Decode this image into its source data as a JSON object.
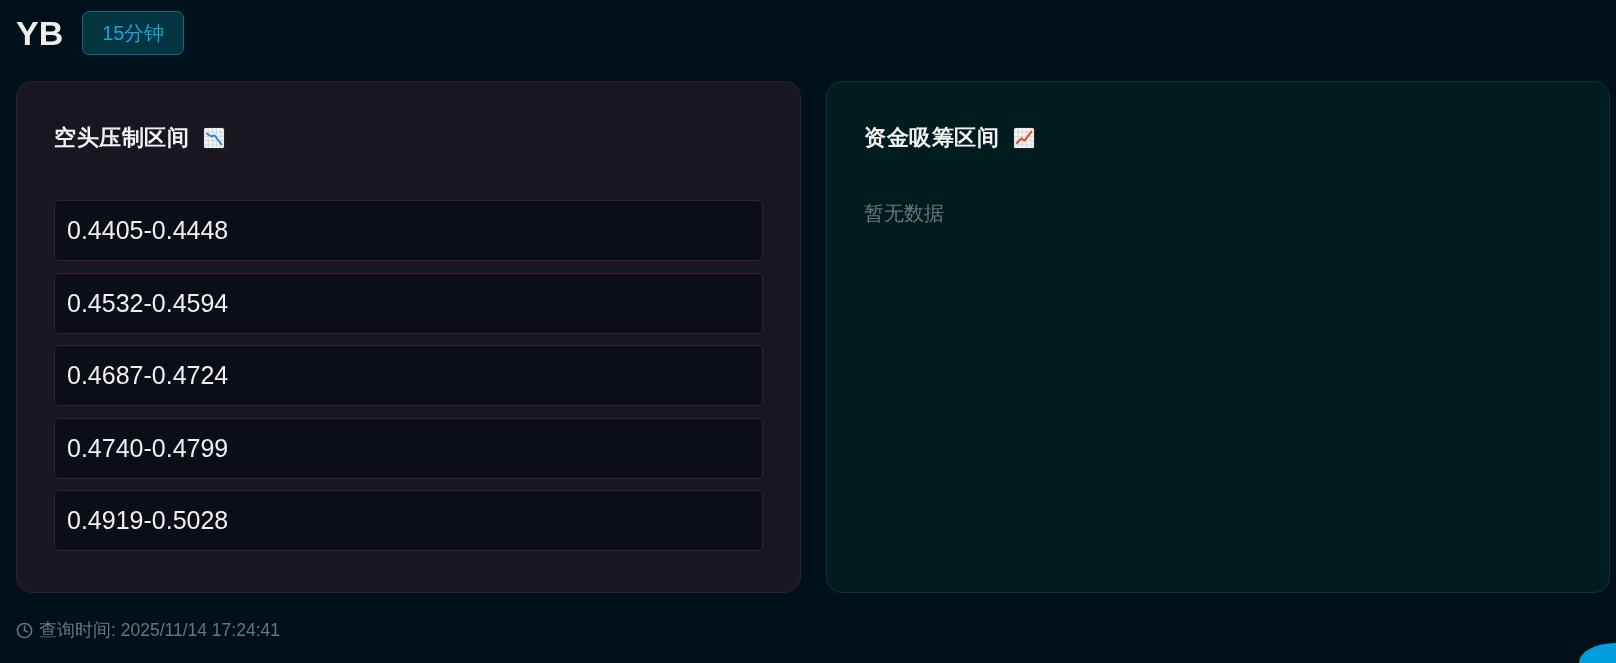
{
  "header": {
    "symbol": "YB",
    "interval_badge": "15分钟"
  },
  "panels": [
    {
      "kind": "bearish",
      "title": "空头压制区间",
      "ranges": [
        "0.4405-0.4448",
        "0.4532-0.4594",
        "0.4687-0.4724",
        "0.4740-0.4799",
        "0.4919-0.5028"
      ]
    },
    {
      "kind": "bullish",
      "title": "资金吸筹区间",
      "empty_text": "暂无数据"
    }
  ],
  "footer": {
    "query_time": "查询时间: 2025/11/14 17:24:41"
  }
}
